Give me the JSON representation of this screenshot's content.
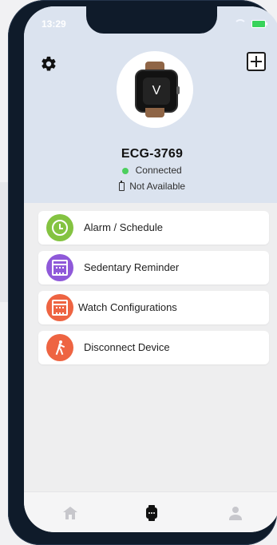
{
  "status_bar": {
    "time": "13:29"
  },
  "device": {
    "name": "ECG-3769",
    "status": "Connected",
    "battery": "Not Available",
    "watch_face_symbol": "V"
  },
  "menu": [
    {
      "label": "Alarm / Schedule",
      "icon": "alarm-clock-icon",
      "color": "#84c341"
    },
    {
      "label": "Sedentary Reminder",
      "icon": "calendar-icon",
      "color": "#8f59d9"
    },
    {
      "label": "Watch Configurations",
      "icon": "calendar-icon",
      "color": "#ee6442"
    },
    {
      "label": "Disconnect Device",
      "icon": "walking-icon",
      "color": "#ee6442"
    }
  ],
  "nav": [
    {
      "icon": "home-icon",
      "color": "#c7c7cc"
    },
    {
      "icon": "watch-icon",
      "color": "#0f0f0f"
    },
    {
      "icon": "profile-icon",
      "color": "#c7c7cc"
    }
  ],
  "colors": {
    "header_bg": "#dbe3ef",
    "connected_dot": "#4ccf5e",
    "phone_frame": "#0f1b2a"
  }
}
